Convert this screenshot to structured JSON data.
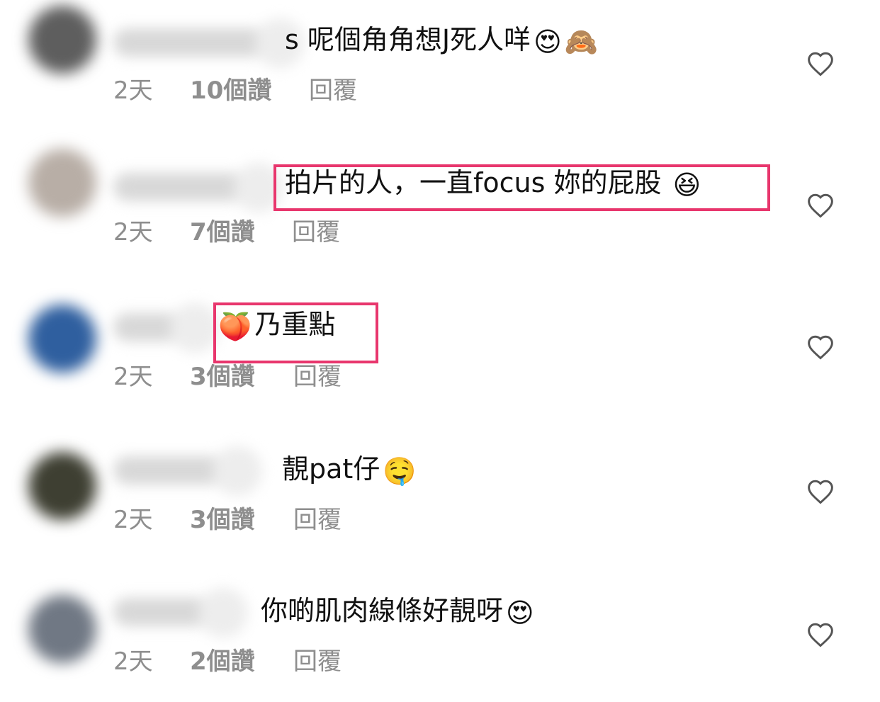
{
  "comments": [
    {
      "text": "s 呢個角角想J死人咩",
      "emojis": [
        "😍",
        "🙈"
      ],
      "time": "2天",
      "likes": "10個讚",
      "reply": "回覆",
      "avatar_color": "#5e5e5e",
      "highlighted": false
    },
    {
      "text": "拍片的人，一直focus 妳的屁股",
      "emojis": [
        "😆"
      ],
      "time": "2天",
      "likes": "7個讚",
      "reply": "回覆",
      "avatar_color": "#b8aea6",
      "highlighted": true
    },
    {
      "text": "乃重點",
      "emojis": [],
      "lead_emoji": "🍑",
      "time": "2天",
      "likes": "3個讚",
      "reply": "回覆",
      "avatar_color": "#2f5f9f",
      "highlighted": true
    },
    {
      "text": "靚pat仔",
      "emojis": [
        "🤤"
      ],
      "time": "2天",
      "likes": "3個讚",
      "reply": "回覆",
      "avatar_color": "#3e3f32",
      "highlighted": false
    },
    {
      "text": "你啲肌肉線條好靚呀",
      "emojis": [
        "😍"
      ],
      "time": "2天",
      "likes": "2個讚",
      "reply": "回覆",
      "avatar_color": "#707884",
      "highlighted": false
    }
  ],
  "icons": {
    "heart": "heart-outline-icon"
  },
  "colors": {
    "highlight": "#e8366d",
    "meta_text": "#8e8e8e",
    "body_text": "#111111"
  }
}
